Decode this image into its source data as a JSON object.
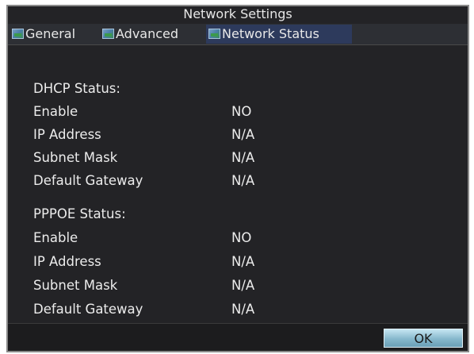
{
  "window": {
    "title": "Network Settings"
  },
  "tabs": [
    {
      "label": "General",
      "icon": "tab-icon",
      "active": false
    },
    {
      "label": "Advanced",
      "icon": "tab-icon",
      "active": false
    },
    {
      "label": "Network Status",
      "icon": "tab-icon",
      "active": true
    }
  ],
  "dhcp": {
    "heading": "DHCP Status:",
    "rows": [
      {
        "label": "Enable",
        "value": "NO"
      },
      {
        "label": "IP Address",
        "value": "N/A"
      },
      {
        "label": "Subnet Mask",
        "value": "N/A"
      },
      {
        "label": "Default Gateway",
        "value": "N/A"
      }
    ]
  },
  "pppoe": {
    "heading": "PPPOE Status:",
    "rows": [
      {
        "label": "Enable",
        "value": "NO"
      },
      {
        "label": "IP Address",
        "value": "N/A"
      },
      {
        "label": "Subnet Mask",
        "value": "N/A"
      },
      {
        "label": "Default Gateway",
        "value": "N/A"
      }
    ]
  },
  "footer": {
    "ok_label": "OK"
  },
  "colors": {
    "background": "#232326",
    "tab_active": "#2d3a5c",
    "text": "#ececec",
    "button": "#86b8cc"
  }
}
